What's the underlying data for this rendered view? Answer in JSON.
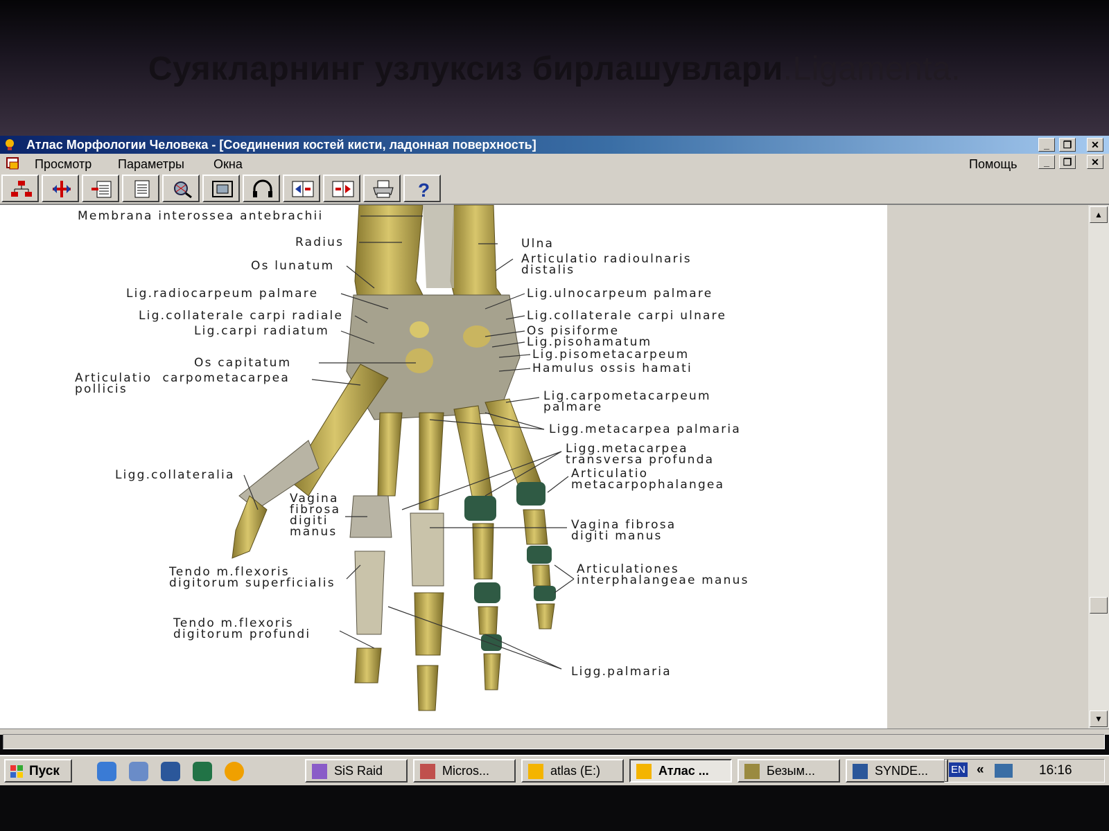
{
  "slide": {
    "title_bold": "Суякларнинг узлуксиз бирлашувлари",
    "title_latin": ".Ligamenta."
  },
  "window": {
    "title": "Атлас Морфологии Человека - [Соединения костей кисти, ладонная поверхность]",
    "menu": [
      "Просмотр",
      "Параметры",
      "Окна"
    ],
    "help": "Помощь",
    "toolbar_icons": [
      "hierarchy-icon",
      "navigate-icon",
      "add-page-icon",
      "document-icon",
      "magnifier-icon",
      "fit-view-icon",
      "headphones-icon",
      "previous-icon",
      "next-icon",
      "print-icon",
      "help-icon"
    ]
  },
  "labels": {
    "membrana": "Membrana interossea antebrachii",
    "radius": "Radius",
    "ulna": "Ulna",
    "os_lunatum": "Os lunatum",
    "art_radioulnaris": "Articulatio radioulnaris\ndistalis",
    "lig_radiocarpeum": "Lig.radiocarpeum palmare",
    "lig_ulnocarpeum": "Lig.ulnocarpeum palmare",
    "lig_coll_radiale": "Lig.collaterale carpi radiale",
    "lig_coll_ulnare": "Lig.collaterale carpi ulnare",
    "lig_carpi_radiatum": "Lig.carpi radiatum",
    "os_pisiforme": "Os pisiforme",
    "lig_pisohamatum": "Lig.pisohamatum",
    "lig_pisometacarpeum": "Lig.pisometacarpeum",
    "os_capitatum": "Os capitatum",
    "hamulus": "Hamulus ossis hamati",
    "art_carpomet_pollicis": "Articulatio  carpometacarpea\npollicis",
    "lig_carpomet_palmare": "Lig.carpometacarpeum\npalmare",
    "ligg_metacarpea_palmaria": "Ligg.metacarpea palmaria",
    "ligg_metacarpea_transversa": "Ligg.metacarpea\ntransversa profunda",
    "ligg_collateralia": "Ligg.collateralia",
    "art_metacarpophalangea": "Articulatio\nmetacarpophalangea",
    "vagina_left": "Vagina\nfibrosa\ndigiti\nmanus",
    "vagina_right": "Vagina fibrosa\ndigiti manus",
    "tendo_superficialis": "Tendo m.flexoris\ndigitorum superficialis",
    "art_interphalangeae": "Articulationes\ninterphalangeae manus",
    "tendo_profundi": "Tendo m.flexoris\ndigitorum profundi",
    "ligg_palmaria": "Ligg.palmaria"
  },
  "taskbar": {
    "start": "Пуск",
    "tasks": [
      "SiS Raid",
      "Micros...",
      "atlas (E:)",
      "Атлас ...",
      "Безым...",
      "SYNDE..."
    ],
    "language": "EN",
    "tray_arrows": "«",
    "clock": "16:16"
  },
  "colors": {
    "bone": "#c9b560",
    "bone_dark": "#8a7a30",
    "ligament": "#b8b4a4",
    "cartilage": "#2f5a44",
    "titlebar": "#0a246a"
  }
}
